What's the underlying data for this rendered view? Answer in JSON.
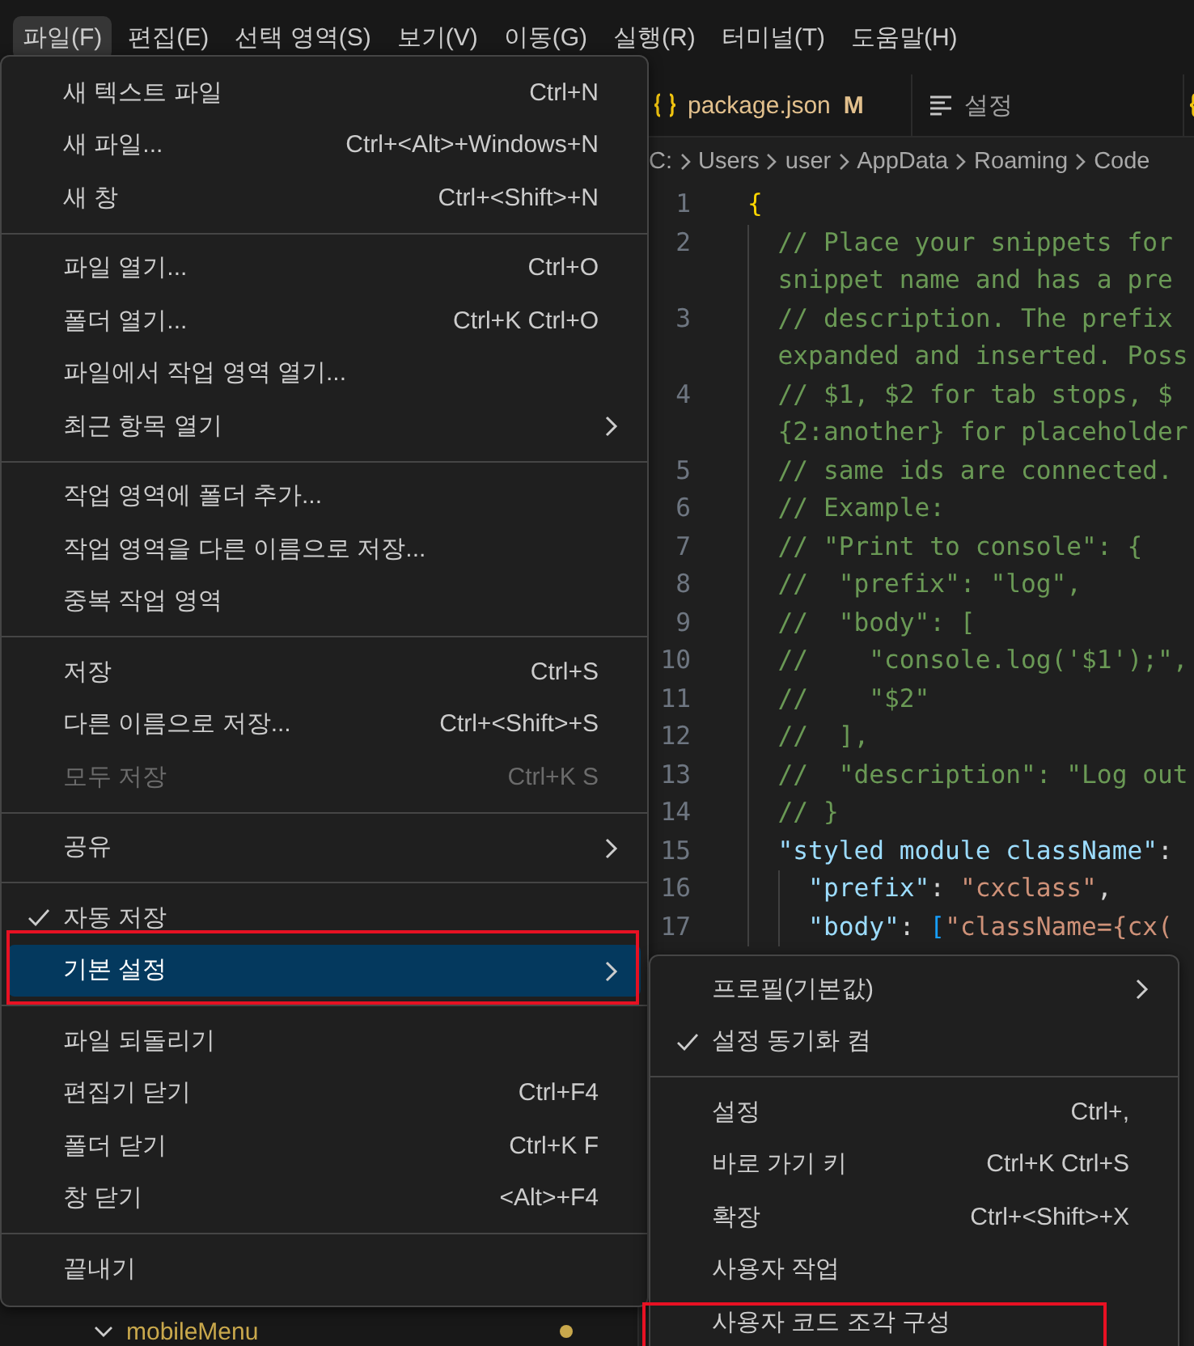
{
  "menubar": [
    {
      "label": "파일(F)",
      "selected": true
    },
    {
      "label": "편집(E)",
      "selected": false
    },
    {
      "label": "선택 영역(S)",
      "selected": false
    },
    {
      "label": "보기(V)",
      "selected": false
    },
    {
      "label": "이동(G)",
      "selected": false
    },
    {
      "label": "실행(R)",
      "selected": false
    },
    {
      "label": "터미널(T)",
      "selected": false
    },
    {
      "label": "도움말(H)",
      "selected": false
    }
  ],
  "tabs": [
    {
      "kind": "json",
      "label": "package.json",
      "badge": "M"
    },
    {
      "kind": "settings",
      "label": "설정"
    },
    {
      "kind": "json"
    }
  ],
  "breadcrumbs": [
    "C:",
    "Users",
    "user",
    "AppData",
    "Roaming",
    "Code"
  ],
  "code_lines": [
    {
      "number": "1",
      "rows": [
        [
          {
            "kind": "brace",
            "text": "{"
          }
        ]
      ]
    },
    {
      "number": "2",
      "rows": [
        [
          {
            "kind": "comment",
            "text": "  // Place your snippets for"
          }
        ],
        [
          {
            "kind": "comment",
            "text": "  snippet name and has a pre"
          }
        ]
      ]
    },
    {
      "number": "3",
      "rows": [
        [
          {
            "kind": "comment",
            "text": "  // description. The prefix"
          }
        ],
        [
          {
            "kind": "comment",
            "text": "  expanded and inserted. Poss"
          }
        ]
      ]
    },
    {
      "number": "4",
      "rows": [
        [
          {
            "kind": "comment",
            "text": "  // $1, $2 for tab stops, $"
          }
        ],
        [
          {
            "kind": "comment",
            "text": "  {2:another} for placeholder"
          }
        ]
      ]
    },
    {
      "number": "5",
      "rows": [
        [
          {
            "kind": "comment",
            "text": "  // same ids are connected."
          }
        ]
      ]
    },
    {
      "number": "6",
      "rows": [
        [
          {
            "kind": "comment",
            "text": "  // Example:"
          }
        ]
      ]
    },
    {
      "number": "7",
      "rows": [
        [
          {
            "kind": "comment",
            "text": "  // \"Print to console\": {"
          }
        ]
      ]
    },
    {
      "number": "8",
      "rows": [
        [
          {
            "kind": "comment",
            "text": "  //  \"prefix\": \"log\","
          }
        ]
      ]
    },
    {
      "number": "9",
      "rows": [
        [
          {
            "kind": "comment",
            "text": "  //  \"body\": ["
          }
        ]
      ]
    },
    {
      "number": "10",
      "rows": [
        [
          {
            "kind": "comment",
            "text": "  //    \"console.log('$1');\","
          }
        ]
      ]
    },
    {
      "number": "11",
      "rows": [
        [
          {
            "kind": "comment",
            "text": "  //    \"$2\""
          }
        ]
      ]
    },
    {
      "number": "12",
      "rows": [
        [
          {
            "kind": "comment",
            "text": "  //  ],"
          }
        ]
      ]
    },
    {
      "number": "13",
      "rows": [
        [
          {
            "kind": "comment",
            "text": "  //  \"description\": \"Log out"
          }
        ]
      ]
    },
    {
      "number": "14",
      "rows": [
        [
          {
            "kind": "comment",
            "text": "  // }"
          }
        ]
      ]
    },
    {
      "number": "15",
      "rows": [
        [
          {
            "kind": "key",
            "text": "  \"styled module className\""
          },
          {
            "kind": "punct",
            "text": ":"
          }
        ]
      ]
    },
    {
      "number": "16",
      "rows": [
        [
          {
            "kind": "key",
            "text": "    \"prefix\""
          },
          {
            "kind": "punct",
            "text": ": "
          },
          {
            "kind": "string",
            "text": "\"cxclass\""
          },
          {
            "kind": "punct",
            "text": ","
          }
        ]
      ]
    },
    {
      "number": "17",
      "rows": [
        [
          {
            "kind": "key",
            "text": "    \"body\""
          },
          {
            "kind": "punct",
            "text": ": "
          },
          {
            "kind": "bracket",
            "text": "["
          },
          {
            "kind": "string",
            "text": "\"className={cx("
          }
        ]
      ]
    }
  ],
  "sidebar": {
    "items": [
      {
        "label": "mobileMenu",
        "expanded": true,
        "color": "#c9a84c"
      }
    ]
  },
  "menu": {
    "items": [
      {
        "kind": "item",
        "label": "새 텍스트 파일",
        "shortcut": "Ctrl+N",
        "submenu": false,
        "checked": false,
        "disabled": false,
        "selected": false,
        "outlined": false
      },
      {
        "kind": "item",
        "label": "새 파일...",
        "shortcut": "Ctrl+<Alt>+Windows+N",
        "submenu": false,
        "checked": false,
        "disabled": false,
        "selected": false,
        "outlined": false
      },
      {
        "kind": "item",
        "label": "새 창",
        "shortcut": "Ctrl+<Shift>+N",
        "submenu": false,
        "checked": false,
        "disabled": false,
        "selected": false,
        "outlined": false
      },
      {
        "kind": "separator"
      },
      {
        "kind": "item",
        "label": "파일 열기...",
        "shortcut": "Ctrl+O",
        "submenu": false,
        "checked": false,
        "disabled": false,
        "selected": false,
        "outlined": false
      },
      {
        "kind": "item",
        "label": "폴더 열기...",
        "shortcut": "Ctrl+K Ctrl+O",
        "submenu": false,
        "checked": false,
        "disabled": false,
        "selected": false,
        "outlined": false
      },
      {
        "kind": "item",
        "label": "파일에서 작업 영역 열기...",
        "submenu": false,
        "checked": false,
        "disabled": false,
        "selected": false,
        "outlined": false
      },
      {
        "kind": "item",
        "label": "최근 항목 열기",
        "submenu": true,
        "checked": false,
        "disabled": false,
        "selected": false,
        "outlined": false
      },
      {
        "kind": "separator"
      },
      {
        "kind": "item",
        "label": "작업 영역에 폴더 추가...",
        "submenu": false,
        "checked": false,
        "disabled": false,
        "selected": false,
        "outlined": false
      },
      {
        "kind": "item",
        "label": "작업 영역을 다른 이름으로 저장...",
        "submenu": false,
        "checked": false,
        "disabled": false,
        "selected": false,
        "outlined": false
      },
      {
        "kind": "item",
        "label": "중복 작업 영역",
        "submenu": false,
        "checked": false,
        "disabled": false,
        "selected": false,
        "outlined": false
      },
      {
        "kind": "separator"
      },
      {
        "kind": "item",
        "label": "저장",
        "shortcut": "Ctrl+S",
        "submenu": false,
        "checked": false,
        "disabled": false,
        "selected": false,
        "outlined": false
      },
      {
        "kind": "item",
        "label": "다른 이름으로 저장...",
        "shortcut": "Ctrl+<Shift>+S",
        "submenu": false,
        "checked": false,
        "disabled": false,
        "selected": false,
        "outlined": false
      },
      {
        "kind": "item",
        "label": "모두 저장",
        "shortcut": "Ctrl+K S",
        "submenu": false,
        "checked": false,
        "disabled": true,
        "selected": false,
        "outlined": false
      },
      {
        "kind": "separator"
      },
      {
        "kind": "item",
        "label": "공유",
        "submenu": true,
        "checked": false,
        "disabled": false,
        "selected": false,
        "outlined": false
      },
      {
        "kind": "separator"
      },
      {
        "kind": "item",
        "label": "자동 저장",
        "submenu": false,
        "checked": true,
        "disabled": false,
        "selected": false,
        "outlined": false
      },
      {
        "kind": "item",
        "label": "기본 설정",
        "submenu": true,
        "checked": false,
        "disabled": false,
        "selected": true,
        "outlined": true
      },
      {
        "kind": "separator"
      },
      {
        "kind": "item",
        "label": "파일 되돌리기",
        "submenu": false,
        "checked": false,
        "disabled": false,
        "selected": false,
        "outlined": false
      },
      {
        "kind": "item",
        "label": "편집기 닫기",
        "shortcut": "Ctrl+F4",
        "submenu": false,
        "checked": false,
        "disabled": false,
        "selected": false,
        "outlined": false
      },
      {
        "kind": "item",
        "label": "폴더 닫기",
        "shortcut": "Ctrl+K F",
        "submenu": false,
        "checked": false,
        "disabled": false,
        "selected": false,
        "outlined": false
      },
      {
        "kind": "item",
        "label": "창 닫기",
        "shortcut": "<Alt>+F4",
        "submenu": false,
        "checked": false,
        "disabled": false,
        "selected": false,
        "outlined": false
      },
      {
        "kind": "separator"
      },
      {
        "kind": "item",
        "label": "끝내기",
        "submenu": false,
        "checked": false,
        "disabled": false,
        "selected": false,
        "outlined": false
      }
    ]
  },
  "submenu": {
    "items": [
      {
        "kind": "item",
        "label": "프로필(기본값)",
        "submenu": true,
        "checked": false,
        "disabled": false,
        "selected": false,
        "outlined": false
      },
      {
        "kind": "item",
        "label": "설정 동기화 켬",
        "submenu": false,
        "checked": true,
        "disabled": false,
        "selected": false,
        "outlined": false
      },
      {
        "kind": "separator"
      },
      {
        "kind": "item",
        "label": "설정",
        "shortcut": "Ctrl+,",
        "submenu": false,
        "checked": false,
        "disabled": false,
        "selected": false,
        "outlined": false
      },
      {
        "kind": "item",
        "label": "바로 가기 키",
        "shortcut": "Ctrl+K Ctrl+S",
        "submenu": false,
        "checked": false,
        "disabled": false,
        "selected": false,
        "outlined": false
      },
      {
        "kind": "item",
        "label": "확장",
        "shortcut": "Ctrl+<Shift>+X",
        "submenu": false,
        "checked": false,
        "disabled": false,
        "selected": false,
        "outlined": false
      },
      {
        "kind": "item",
        "label": "사용자 작업",
        "submenu": false,
        "checked": false,
        "disabled": false,
        "selected": false,
        "outlined": false
      },
      {
        "kind": "item",
        "label": "사용자 코드 조각 구성",
        "submenu": false,
        "checked": false,
        "disabled": false,
        "selected": false,
        "outlined": true
      }
    ]
  }
}
